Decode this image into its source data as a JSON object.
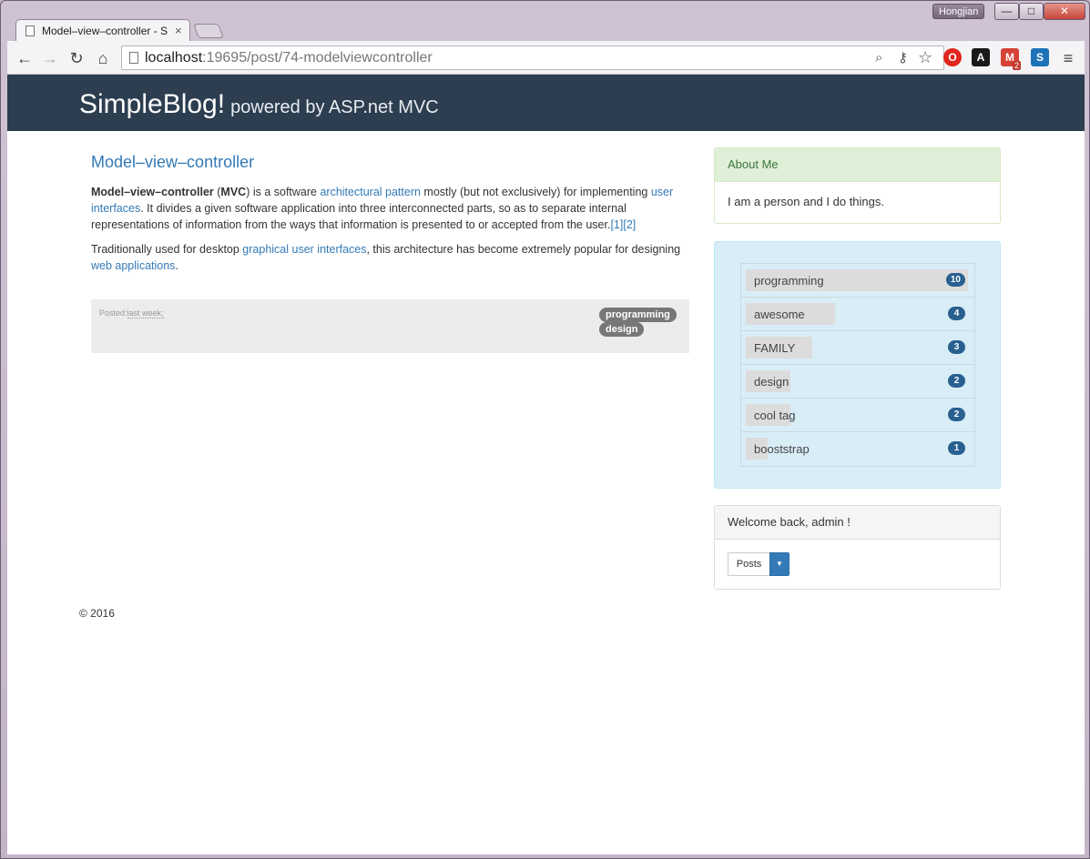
{
  "browser": {
    "user_name": "Hongjian",
    "window_buttons": {
      "minimize": "—",
      "maximize": "□",
      "close": "✕"
    },
    "tab": {
      "title": "Model–view–controller - S",
      "close": "×"
    },
    "address": {
      "host": "localhost",
      "path": ":19695/post/74-modelviewcontroller"
    },
    "nav": {
      "back": "←",
      "forward": "→",
      "reload": "↻",
      "home": "⌂"
    },
    "omnibox_icons": {
      "search": "⌕",
      "key": "⚷",
      "star": "☆"
    },
    "extensions": [
      {
        "name": "opera-icon",
        "label": "O",
        "color": "#e0261d"
      },
      {
        "name": "acrobat-icon",
        "label": "A",
        "color": "#1a1a1a"
      },
      {
        "name": "gmail-icon",
        "label": "M",
        "color": "#d54135"
      },
      {
        "name": "s-icon",
        "label": "S",
        "color": "#1e73b8"
      }
    ],
    "gmail_badge": "2",
    "menu": "≡"
  },
  "site": {
    "brand": "SimpleBlog!",
    "tagline": "powered by ASP.net MVC"
  },
  "post": {
    "title": "Model–view–controller",
    "p1": {
      "bold": "Model–view–controller",
      "t1": " (",
      "abbr": "MVC",
      "t2": ") is a software ",
      "link1": "architectural pattern",
      "t3": " mostly (but not exclusively) for implementing ",
      "link2": "user interfaces",
      "t4": ". It divides a given software application into three interconnected parts, so as to separate internal representations of information from the ways that information is presented to or accepted from the user.",
      "ref1": "[1]",
      "ref2": "[2]"
    },
    "p2": {
      "t1": "Traditionally used for desktop ",
      "link1": "graphical user interfaces",
      "t2": ", this architecture has become extremely popular for designing ",
      "link2": "web applications",
      "t3": "."
    },
    "posted_label": "Posted:",
    "posted_when": "last week;",
    "tags": [
      "programming",
      "design"
    ]
  },
  "about": {
    "heading": "About Me",
    "body": "I am a person and I do things."
  },
  "tag_cloud": [
    {
      "name": "programming",
      "count": 10
    },
    {
      "name": "awesome",
      "count": 4
    },
    {
      "name": "FAMILY",
      "count": 3
    },
    {
      "name": "design",
      "count": 2
    },
    {
      "name": "cool tag",
      "count": 2
    },
    {
      "name": "booststrap",
      "count": 1
    }
  ],
  "welcome": {
    "heading": "Welcome back, admin !",
    "posts_button": "Posts",
    "caret": "▼"
  },
  "footer": {
    "copyright": "© 2016"
  }
}
